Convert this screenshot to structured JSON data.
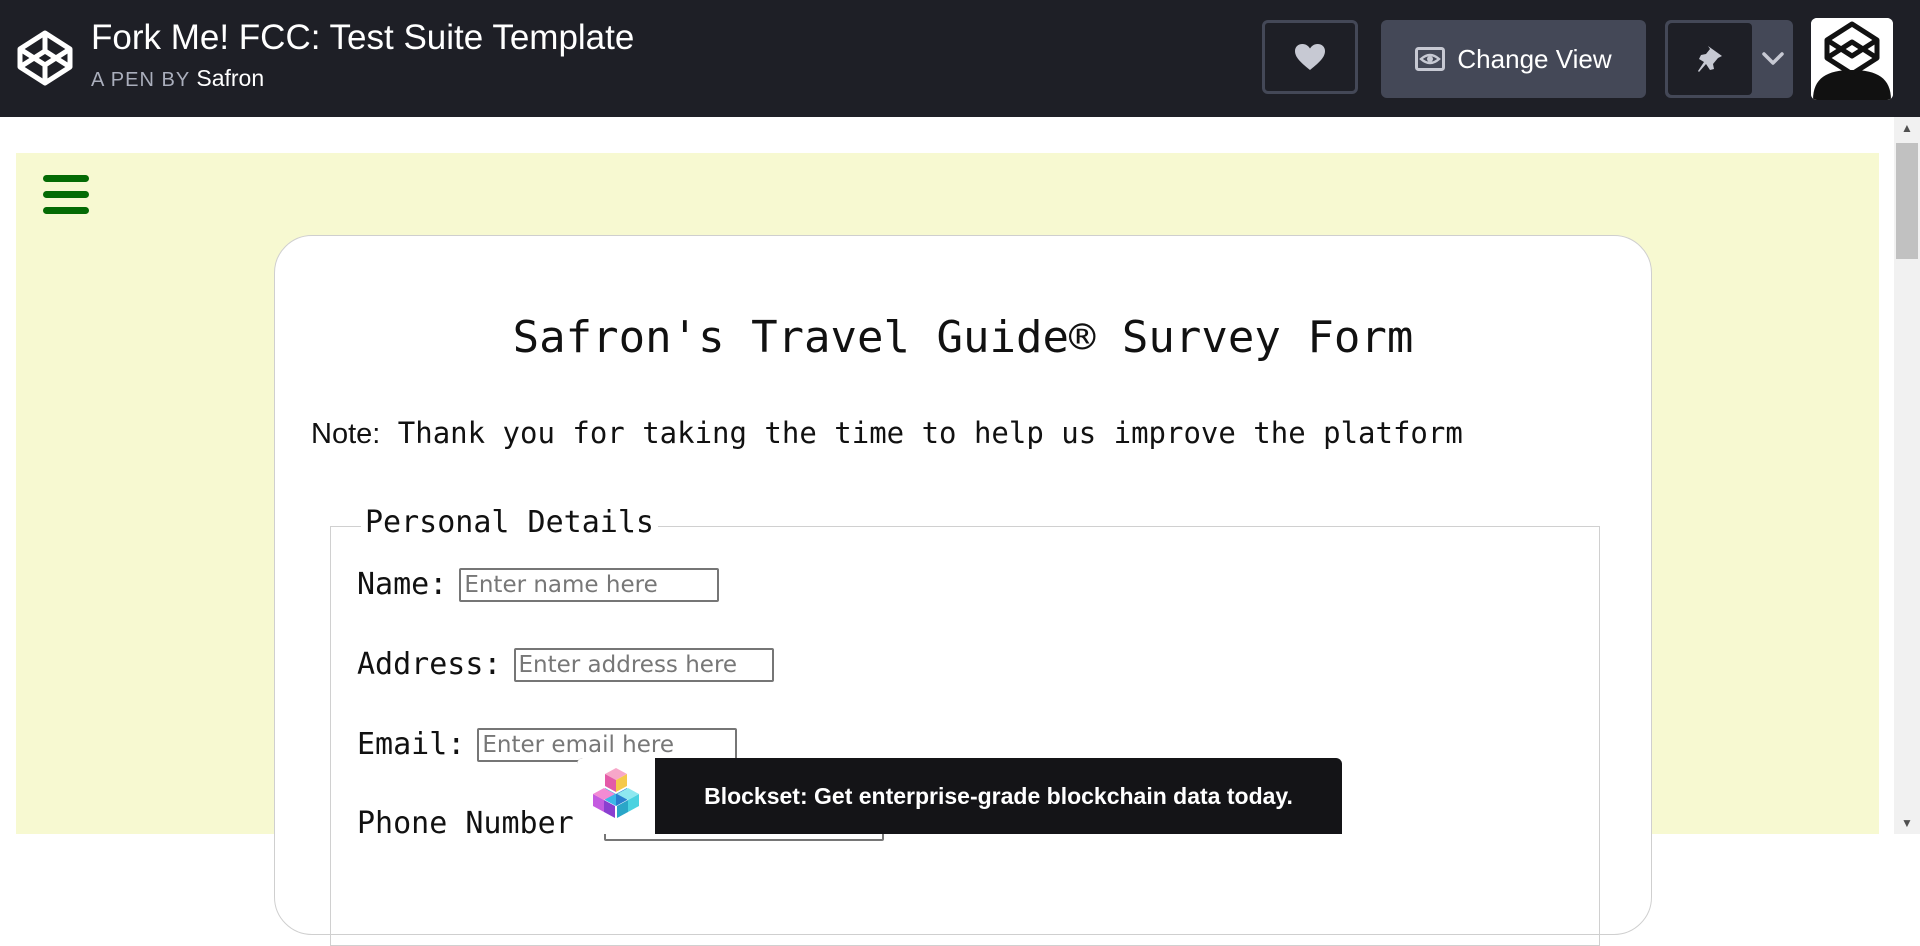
{
  "header": {
    "title": "Fork Me! FCC: Test Suite Template",
    "byline_prefix": "A PEN BY",
    "author": "Safron",
    "change_view_label": "Change View"
  },
  "form": {
    "title": "Safron's Travel Guide® Survey Form",
    "note_label": "Note:",
    "note_text": " Thank you for taking the time to help us improve the platform",
    "fieldset_legend": "Personal Details",
    "fields": [
      {
        "label": "Name:",
        "placeholder": "Enter name here"
      },
      {
        "label": "Address:",
        "placeholder": "Enter address here"
      },
      {
        "label": "Email:",
        "placeholder": "Enter email here"
      },
      {
        "label": "Phone Number:",
        "placeholder": "E"
      }
    ]
  },
  "ad": {
    "text": "Blockset: Get enterprise-grade blockchain data today."
  },
  "colors": {
    "header_bg": "#1e1f26",
    "button_bg": "#444857",
    "page_bg": "#f7f9d1",
    "hamburger": "#046b04",
    "ad_bg": "#141417"
  },
  "icons": [
    "codepen-logo-icon",
    "heart-icon",
    "eye-icon",
    "pin-icon",
    "chevron-down-icon",
    "menu-icon",
    "blockset-cube-icon"
  ]
}
